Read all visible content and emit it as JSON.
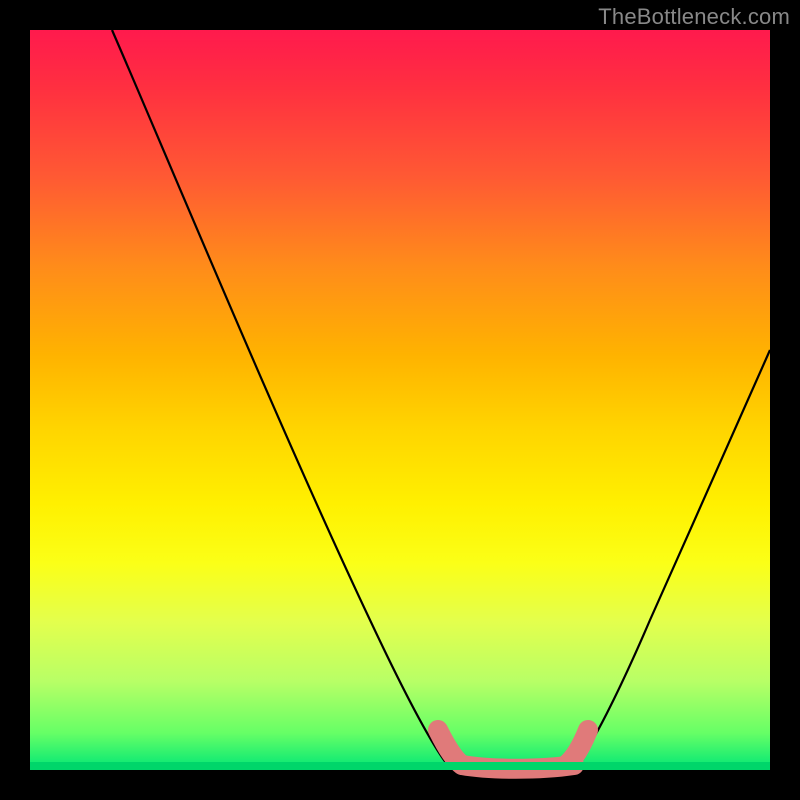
{
  "watermark": "TheBottleneck.com",
  "chart_data": {
    "type": "line",
    "title": "",
    "xlabel": "",
    "ylabel": "",
    "xlim": [
      0,
      100
    ],
    "ylim": [
      0,
      100
    ],
    "grid": false,
    "series": [
      {
        "name": "left-curve",
        "color": "#000000",
        "x": [
          11,
          20,
          30,
          40,
          48,
          53,
          56.5
        ],
        "values": [
          100,
          79,
          55,
          31,
          12,
          3,
          0
        ]
      },
      {
        "name": "right-curve",
        "color": "#000000",
        "x": [
          73.5,
          76,
          80,
          85,
          90,
          95,
          100
        ],
        "values": [
          0,
          3,
          10,
          21,
          33,
          45,
          57
        ]
      },
      {
        "name": "bottom-blob",
        "color": "#e07a7a",
        "x_segments": [
          [
            55,
            58
          ],
          [
            58,
            74
          ],
          [
            72,
            75
          ]
        ],
        "values_segments": [
          [
            5,
            1
          ],
          [
            1,
            1
          ],
          [
            1,
            5
          ]
        ]
      }
    ],
    "background_gradient": {
      "stops": [
        {
          "pos": 0,
          "color": "#ff1a4d"
        },
        {
          "pos": 20,
          "color": "#ff5a33"
        },
        {
          "pos": 44,
          "color": "#ffb300"
        },
        {
          "pos": 64,
          "color": "#fff000"
        },
        {
          "pos": 88,
          "color": "#b8ff66"
        },
        {
          "pos": 100,
          "color": "#00e676"
        }
      ]
    }
  }
}
